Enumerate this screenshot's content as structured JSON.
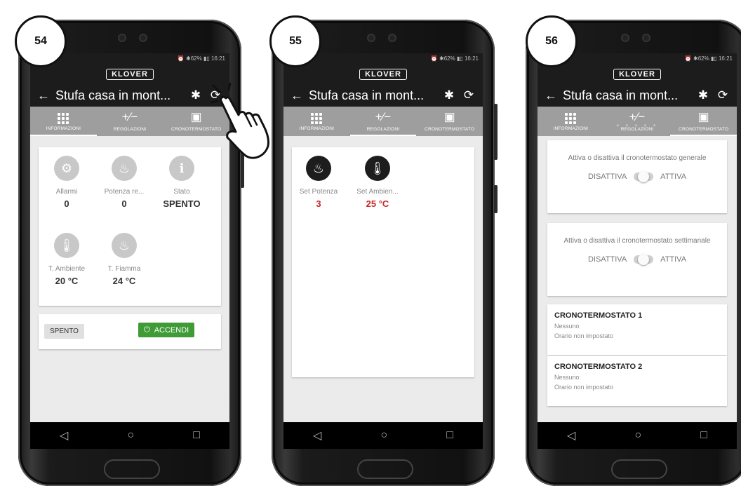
{
  "status_bar": {
    "text": "⏰ ✱62% ▮▯ 16:21"
  },
  "brand": "KLOVER",
  "appbar": {
    "title": "Stufa casa in mont...",
    "back_icon": "←",
    "bluetooth_icon": "✱",
    "refresh_icon": "⟳"
  },
  "tabs": [
    {
      "label": "INFORMAZIONI"
    },
    {
      "label": "REGOLAZIONI"
    },
    {
      "label": "CRONOTERMOSTATO"
    }
  ],
  "screens": [
    {
      "badge": "54",
      "active_tab": "INFORMAZIONI",
      "tiles": [
        {
          "label": "Allarmi",
          "value": "0",
          "icon": "gears-icon"
        },
        {
          "label": "Potenza re...",
          "value": "0",
          "icon": "flame-icon"
        },
        {
          "label": "Stato",
          "value": "SPENTO",
          "icon": "info-icon"
        },
        {
          "label": "T. Ambiente",
          "value": "20 °C",
          "icon": "thermometer-icon"
        },
        {
          "label": "T. Fiamma",
          "value": "24 °C",
          "icon": "flame-thermo-icon"
        }
      ],
      "status_button": "SPENTO",
      "power_button": "ACCENDI"
    },
    {
      "badge": "55",
      "active_tab": "REGOLAZIONI",
      "tiles": [
        {
          "label": "Set Potenza",
          "value": "3",
          "icon": "flame-icon"
        },
        {
          "label": "Set Ambien...",
          "value": "25 °C",
          "icon": "thermometer-icon"
        }
      ]
    },
    {
      "badge": "56",
      "active_tab": "CRONOTERMOSTATO",
      "pager": "● ● ● ● ●",
      "cards": [
        {
          "text": "Attiva o disattiva il cronotermostato generale",
          "off": "DISATTIVA",
          "on": "ATTIVA"
        },
        {
          "text": "Attiva o disattiva il cronotermostato settimanale",
          "off": "DISATTIVA",
          "on": "ATTIVA"
        }
      ],
      "programs": [
        {
          "title": "CRONOTERMOSTATO 1",
          "sub1": "Nessuno",
          "sub2": "Orario non impostato"
        },
        {
          "title": "CRONOTERMOSTATO 2",
          "sub1": "Nessuno",
          "sub2": "Orario non impostato"
        }
      ]
    }
  ],
  "nav": {
    "back": "◁",
    "home": "○",
    "recent": "□"
  }
}
